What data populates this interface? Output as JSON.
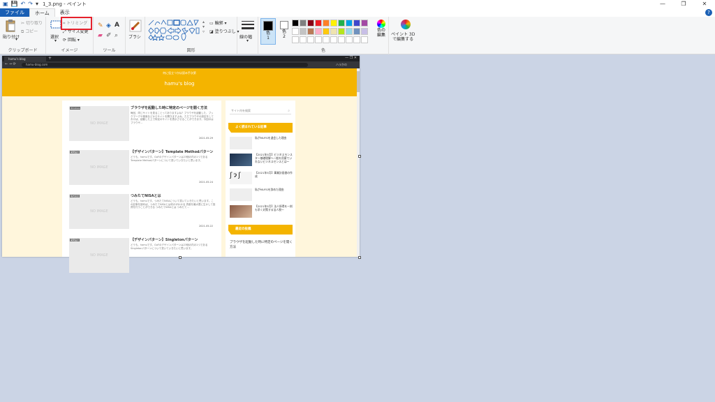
{
  "title": "1_3.png - ペイント",
  "menu": {
    "file": "ファイル",
    "home": "ホーム",
    "view": "表示"
  },
  "clipboard": {
    "paste": "貼り付け",
    "cut": "切り取り",
    "copy": "コピー",
    "label": "クリップボード"
  },
  "image": {
    "select": "選択",
    "crop": "トリミング",
    "resize": "サイズ変更",
    "rotate": "回転",
    "label": "イメージ"
  },
  "tools": {
    "label": "ツール"
  },
  "brush": {
    "label": "ブラシ"
  },
  "shapes": {
    "outline": "輪郭",
    "fill": "塗りつぶし",
    "label": "図形"
  },
  "size": {
    "label": "線の幅"
  },
  "colors": {
    "color1": "色\n1",
    "color2": "色\n2",
    "edit": "色の\n編集",
    "label": "色",
    "palette": [
      "#000000",
      "#7f7f7f",
      "#880015",
      "#ed1c24",
      "#ff7f27",
      "#fff200",
      "#22b14c",
      "#00a2e8",
      "#3f48cc",
      "#a349a4",
      "#ffffff",
      "#c3c3c3",
      "#b97a57",
      "#ffaec9",
      "#ffc90e",
      "#efe4b0",
      "#b5e61d",
      "#99d9ea",
      "#7092be",
      "#c8bfe7"
    ]
  },
  "paint3d": {
    "label": "ペイント 3D\nで編集する"
  },
  "browser": {
    "tab": "hamu's blog",
    "url": "hamu-blog.com",
    "account": "ハラかの"
  },
  "blog": {
    "tagline": "何に役立つかは読み手次第",
    "name": "hamu's blog",
    "no_image": "NO IMAGE",
    "posts": [
      {
        "cat": "Windows",
        "title": "ブラウザを起動した時に特定のページを開く方法",
        "excerpt": "毎回、同じサイトを見ることってありますよね？ブラウザを起動した、ブックマークや検索などからサイトを開きますよね。ただブラウザの設定をしておけば、起動した上で特定のサイトを表示させることができます。今回のはブラウザ…",
        "date": "2021.05.29"
      },
      {
        "cat": "開発設計",
        "title": "【デザインパターン】Template Methodパターン",
        "excerpt": "どうも、hamuです。GoFのデザインパターンは23個の内の1つであるTemplate Methodパターンについて書いていきたいと思います。",
        "date": "2021.05.24"
      },
      {
        "cat": "株式投資",
        "title": "つみたてNISAとは",
        "excerpt": "どうも、hamuです。つみたてNISAについて書いていきたいと思います。この記事を読めば、つみたてNISAとは何かがわかる 資産を最大限に生かして投資を行うことができる つみたてNISAとは つみたて…",
        "date": "2021.05.22"
      },
      {
        "cat": "開発設計",
        "title": "【デザインパターン】Singletonパターン",
        "excerpt": "どうも、hamuです。GoFのデザインパターンは23個の内の1つであるSingletonパターンについて書いていきたいと思います。",
        "date": ""
      }
    ],
    "side": {
      "search": "サイト内を検索",
      "popular": "よく読まれている記事",
      "items": [
        "私がMUFGを退会した理由",
        "【2021年5月】ビジネスモンスター基礎理解へ一般を用意ていれないビジネスセンスとは〜",
        "【2021年5月】事業計画書の作成",
        "私がMUFGを辞めた理由",
        "【2021年5月】法人所得を一刻も早く対策する法人税〜"
      ],
      "recent": "最近の投稿",
      "recent_item": "ブラウザを起動した時に特定のページを開く方法"
    }
  }
}
